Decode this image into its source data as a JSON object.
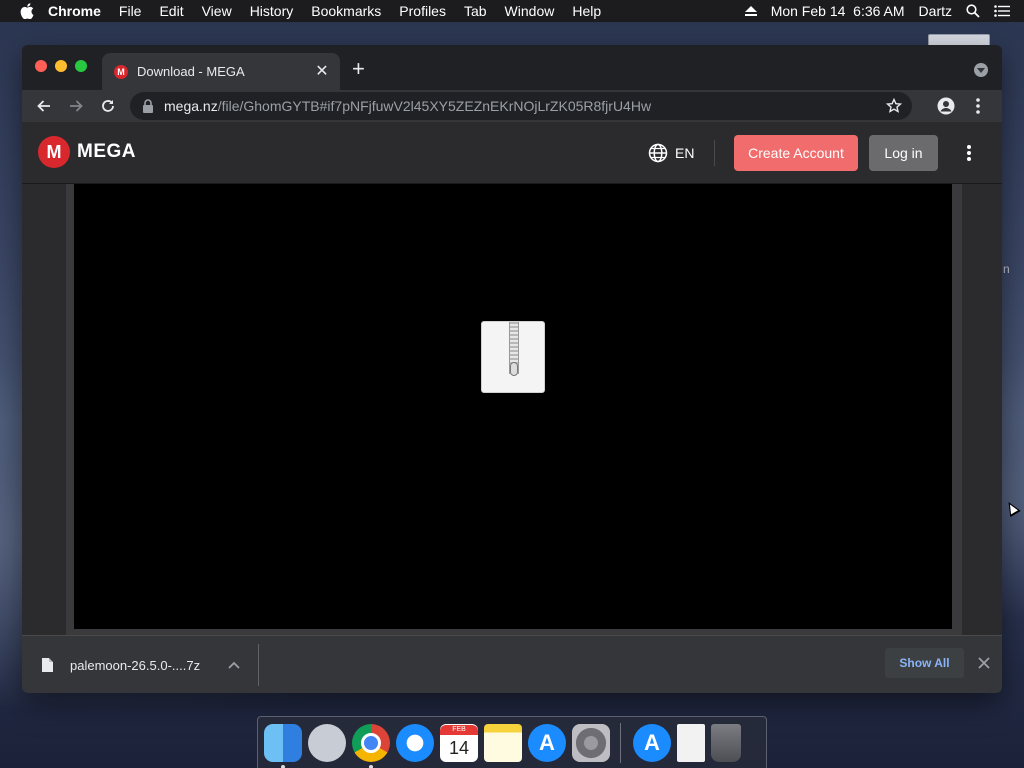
{
  "menubar": {
    "app_name": "Chrome",
    "items": [
      "File",
      "Edit",
      "View",
      "History",
      "Bookmarks",
      "Profiles",
      "Tab",
      "Window",
      "Help"
    ],
    "datetime": "Mon Feb 14  6:36 AM",
    "user": "Dartz"
  },
  "browser": {
    "tab_title": "Download - MEGA",
    "tab_favicon": "M",
    "url_domain": "mega.nz",
    "url_path": "/file/GhomGYTB#if7pNFjfuwV2l45XY5ZEZnEKrNOjLrZK05R8fjrU4Hw"
  },
  "mega": {
    "logo_letter": "M",
    "logo_text": "MEGA",
    "language": "EN",
    "create_account": "Create Account",
    "log_in": "Log in",
    "accent_color": "#d9272e"
  },
  "download_shelf": {
    "file_name": "palemoon-26.5.0-....7z",
    "show_all": "Show All"
  },
  "dock": {
    "calendar_month": "FEB",
    "calendar_day": "14",
    "apps": [
      "finder-icon",
      "launchpad-icon",
      "chrome-icon",
      "safari-icon",
      "calendar-icon",
      "notes-icon",
      "app-store-icon",
      "system-preferences-icon",
      "app-store-download-icon",
      "document-icon",
      "trash-icon"
    ]
  }
}
